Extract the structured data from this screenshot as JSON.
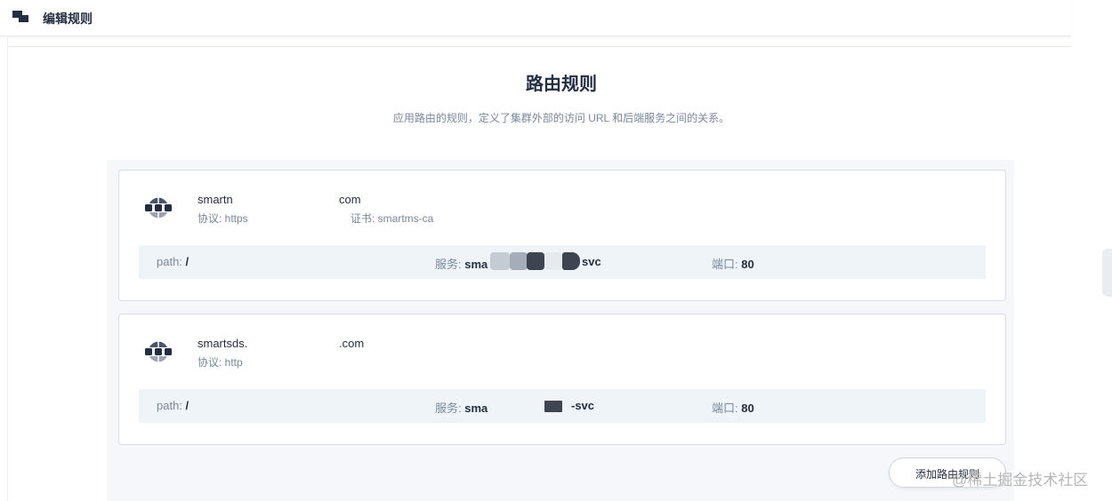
{
  "header": {
    "title": "编辑规则",
    "logo_icon": "stacked-squares-icon"
  },
  "main": {
    "title": "路由规则",
    "description": "应用路由的规则，定义了集群外部的访问 URL 和后端服务之间的关系。"
  },
  "rules": [
    {
      "icon": "globe-icon",
      "host_prefix": "smartn",
      "host_suffix": "com",
      "protocol": "协议: https",
      "certificate": "证书: smartms-ca",
      "path_label": "path:",
      "path_value": "/",
      "service_label": "服务:",
      "service_prefix": "sma",
      "service_suffix": "svc",
      "port_label": "端口:",
      "port_value": "80"
    },
    {
      "icon": "globe-icon",
      "host_prefix": "smartsds.",
      "host_suffix": ".com",
      "protocol": "协议: http",
      "path_label": "path:",
      "path_value": "/",
      "service_label": "服务:",
      "service_prefix": "sma",
      "service_suffix": "-svc",
      "port_label": "端口:",
      "port_value": "80"
    }
  ],
  "actions": {
    "add_rule": "添加路由规则"
  },
  "watermark": "@稀土掘金技术社区",
  "colors": {
    "text": "#242e42",
    "muted": "#79879c",
    "row_bg": "#eff4f9",
    "panel_bg": "#f5f7fa"
  }
}
